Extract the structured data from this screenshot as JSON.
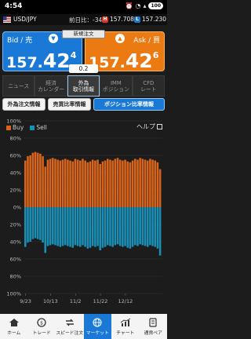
{
  "status_bar": {
    "time": "4:54",
    "battery": "100"
  },
  "pair_bar": {
    "pair": "USD/JPY",
    "prev_label": "前日比：",
    "prev_value": "-341",
    "high_tag": "H",
    "high_value": "157.708",
    "low_tag": "L",
    "low_value": "157.230"
  },
  "quote": {
    "new_order": "新規注文",
    "bid_label": "Bid / 売",
    "ask_label": "Ask / 買",
    "bid_price": {
      "prefix": "157.",
      "big": "42",
      "sup": "4"
    },
    "ask_price": {
      "prefix": "157.",
      "big": "42",
      "sup": "6"
    },
    "spread": "0.2"
  },
  "tabs": [
    {
      "line1": "ニュース",
      "line2": "",
      "active": false
    },
    {
      "line1": "経済",
      "line2": "カレンダー",
      "active": false
    },
    {
      "line1": "外為",
      "line2": "取引情報",
      "active": true
    },
    {
      "line1": "IMM",
      "line2": "ポジション",
      "active": false
    },
    {
      "line1": "CFD",
      "line2": "レート",
      "active": false
    }
  ],
  "subtabs": [
    {
      "label": "外為注文情報",
      "active": false
    },
    {
      "label": "売買比率情報",
      "active": false
    },
    {
      "label": "ポジション比率情報",
      "active": true
    }
  ],
  "help": "ヘルプ",
  "colors": {
    "buy": "#d8641b",
    "sell": "#1a8fb5",
    "accent": "#1a79d6"
  },
  "chart_data": {
    "type": "bar",
    "stacked": "diverging",
    "series": [
      {
        "name": "Buy",
        "values": [
          54,
          59,
          60,
          63,
          64,
          63,
          62,
          59,
          47,
          55,
          56,
          57,
          56,
          55,
          54,
          55,
          56,
          55,
          54,
          53,
          56,
          55,
          54,
          56,
          54,
          52,
          53,
          55,
          54,
          55,
          50,
          53,
          54,
          56,
          55,
          54,
          56,
          57,
          55,
          54,
          55,
          53,
          52,
          54,
          56,
          55,
          57,
          56,
          55,
          54,
          56,
          55,
          54,
          52,
          44
        ]
      },
      {
        "name": "Sell",
        "values": [
          46,
          41,
          40,
          37,
          36,
          37,
          38,
          41,
          53,
          45,
          44,
          43,
          44,
          45,
          46,
          45,
          44,
          45,
          46,
          47,
          44,
          45,
          46,
          44,
          46,
          48,
          47,
          45,
          46,
          45,
          50,
          47,
          46,
          44,
          45,
          46,
          44,
          43,
          45,
          46,
          45,
          47,
          48,
          46,
          44,
          45,
          43,
          44,
          45,
          46,
          44,
          45,
          46,
          48,
          56
        ]
      }
    ],
    "y_ticks": [
      "100%",
      "80%",
      "60%",
      "40%",
      "20%",
      "0%",
      "20%",
      "40%",
      "60%",
      "80%",
      "100%"
    ],
    "x_labels": [
      "9/23",
      "10/13",
      "11/2",
      "11/22",
      "12/12"
    ],
    "ylim": [
      -100,
      100
    ],
    "grid": true,
    "legend": "top-left"
  },
  "bottom_nav": [
    {
      "label": "ホーム",
      "icon": "home-icon",
      "active": false
    },
    {
      "label": "トレード",
      "icon": "trade-icon",
      "active": false
    },
    {
      "label": "スピード注文",
      "icon": "speed-order-icon",
      "active": false
    },
    {
      "label": "マーケット",
      "icon": "globe-icon",
      "active": true
    },
    {
      "label": "チャート",
      "icon": "chart-icon",
      "active": false
    },
    {
      "label": "通貨ペア",
      "icon": "currency-pair-icon",
      "active": false
    }
  ]
}
